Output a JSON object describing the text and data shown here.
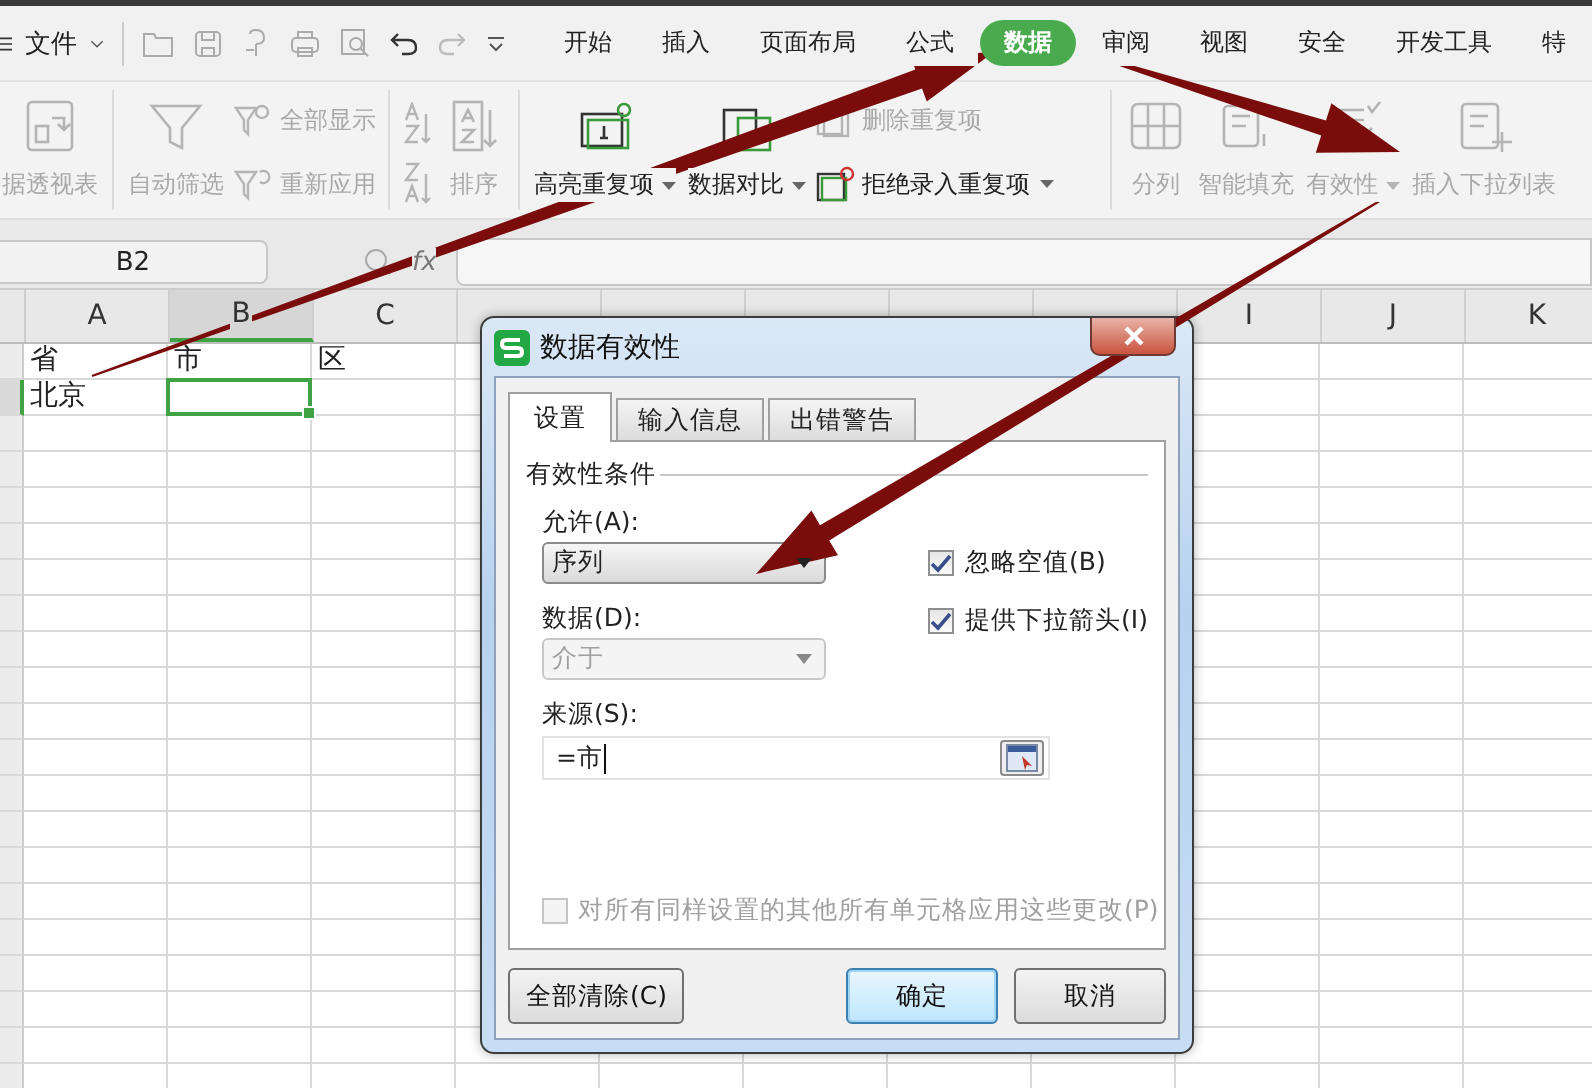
{
  "menu_bar": {
    "file_menu": "文件",
    "tabs": [
      {
        "label": "开始",
        "selected": false
      },
      {
        "label": "插入",
        "selected": false
      },
      {
        "label": "页面布局",
        "selected": false
      },
      {
        "label": "公式",
        "selected": false
      },
      {
        "label": "数据",
        "selected": true
      },
      {
        "label": "审阅",
        "selected": false
      },
      {
        "label": "视图",
        "selected": false
      },
      {
        "label": "安全",
        "selected": false
      },
      {
        "label": "开发工具",
        "selected": false
      },
      {
        "label": "特",
        "selected": false
      }
    ]
  },
  "ribbon": [
    {
      "items": [
        {
          "kind": "large",
          "label": "据透视表",
          "disabled": true,
          "dropdown": false
        }
      ]
    },
    {
      "items": [
        {
          "kind": "large",
          "label": "自动筛选",
          "disabled": true,
          "dropdown": false
        },
        {
          "kind": "small",
          "label": "全部显示",
          "disabled": true,
          "dropdown": false
        },
        {
          "kind": "small",
          "label": "重新应用",
          "disabled": true,
          "dropdown": false
        }
      ]
    },
    {
      "items": [
        {
          "kind": "icons",
          "disabled": true
        },
        {
          "kind": "large",
          "label": "排序",
          "disabled": true,
          "dropdown": false
        }
      ]
    },
    {
      "items": [
        {
          "kind": "large",
          "label": "高亮重复项",
          "disabled": false,
          "dropdown": true
        },
        {
          "kind": "large",
          "label": "数据对比",
          "disabled": false,
          "dropdown": true
        },
        {
          "kind": "small",
          "label": "删除重复项",
          "disabled": true,
          "dropdown": false
        },
        {
          "kind": "small",
          "label": "拒绝录入重复项",
          "disabled": false,
          "dropdown": true
        }
      ]
    },
    {
      "items": [
        {
          "kind": "large",
          "label": "分列",
          "disabled": true,
          "dropdown": false
        },
        {
          "kind": "large",
          "label": "智能填充",
          "disabled": true,
          "dropdown": false
        },
        {
          "kind": "large",
          "label": "有效性",
          "disabled": true,
          "dropdown": true
        },
        {
          "kind": "large",
          "label": "插入下拉列表",
          "disabled": true,
          "dropdown": false
        }
      ]
    }
  ],
  "formula_bar": {
    "name_box": "B2",
    "fx": "fx"
  },
  "sheet": {
    "columns": [
      {
        "label": "A",
        "selected": false
      },
      {
        "label": "B",
        "selected": true
      },
      {
        "label": "C",
        "selected": false
      },
      {
        "label": "I",
        "selected": false
      },
      {
        "label": "J",
        "selected": false
      },
      {
        "label": "K",
        "selected": false
      }
    ],
    "rows": [
      {
        "selected": false,
        "cells": [
          {
            "text": "省",
            "selected": false
          },
          {
            "text": "市",
            "selected": false
          },
          {
            "text": "区",
            "selected": false
          }
        ]
      },
      {
        "selected": true,
        "cells": [
          {
            "text": "北京",
            "selected": false
          },
          {
            "selected": true
          }
        ]
      }
    ]
  },
  "dialog": {
    "title": "数据有效性",
    "tabs": [
      {
        "label": "设置",
        "selected": true
      },
      {
        "label": "输入信息",
        "selected": false
      },
      {
        "label": "出错警告",
        "selected": false
      }
    ],
    "group_title": "有效性条件",
    "allow": {
      "label": "允许(A):",
      "value": "序列",
      "disabled": false
    },
    "data": {
      "label": "数据(D):",
      "value": "介于",
      "disabled": true
    },
    "options": [
      {
        "label": "忽略空值(B)",
        "checked": true
      },
      {
        "label": "提供下拉箭头(I)",
        "checked": true
      }
    ],
    "source": {
      "label": "来源(S):",
      "value": "=市"
    },
    "apply_all": {
      "label": "对所有同样设置的其他所有单元格应用这些更改(P)",
      "checked": false,
      "disabled": true
    },
    "buttons": [
      {
        "label": "全部清除(C)",
        "default": false
      },
      {
        "label": "确定",
        "default": true
      },
      {
        "label": "取消",
        "default": false
      }
    ]
  }
}
